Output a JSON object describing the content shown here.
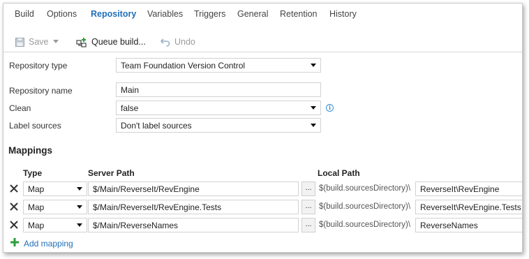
{
  "tabs": [
    "Build",
    "Options",
    "Repository",
    "Variables",
    "Triggers",
    "General",
    "Retention",
    "History"
  ],
  "active_tab": "Repository",
  "toolbar": {
    "save_label": "Save",
    "queue_label": "Queue build...",
    "undo_label": "Undo"
  },
  "form": {
    "repo_type_label": "Repository type",
    "repo_type_value": "Team Foundation Version Control",
    "repo_name_label": "Repository name",
    "repo_name_value": "Main",
    "clean_label": "Clean",
    "clean_value": "false",
    "label_sources_label": "Label sources",
    "label_sources_value": "Don't label sources"
  },
  "mappings": {
    "title": "Mappings",
    "col_type": "Type",
    "col_server": "Server Path",
    "col_local": "Local Path",
    "browse_label": "...",
    "rows": [
      {
        "type": "Map",
        "server_path": "$/Main/ReverseIt/RevEngine",
        "local_prefix": "$(build.sourcesDirectory)\\",
        "local_path": "ReverseIt\\RevEngine"
      },
      {
        "type": "Map",
        "server_path": "$/Main/ReverseIt/RevEngine.Tests",
        "local_prefix": "$(build.sourcesDirectory)\\",
        "local_path": "ReverseIt\\RevEngine.Tests"
      },
      {
        "type": "Map",
        "server_path": "$/Main/ReverseNames",
        "local_prefix": "$(build.sourcesDirectory)\\",
        "local_path": "ReverseNames"
      }
    ],
    "add_label": "Add mapping"
  },
  "colors": {
    "accent": "#1f6fb8",
    "add_green": "#2e9e3a",
    "info_blue": "#3b8fd6"
  },
  "icons": {
    "save": "floppy-disk-icon",
    "queue": "queue-build-icon",
    "undo": "undo-arrow-icon",
    "remove": "close-x-icon",
    "add": "plus-icon",
    "info": "info-icon",
    "dropdown": "chevron-down-icon"
  }
}
